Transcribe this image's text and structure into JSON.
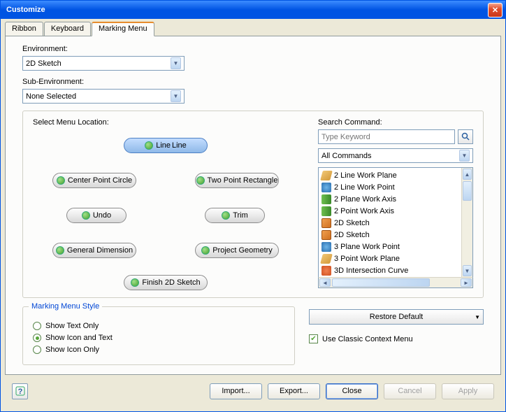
{
  "window": {
    "title": "Customize"
  },
  "tabs": {
    "t0": "Ribbon",
    "t1": "Keyboard",
    "t2": "Marking Menu"
  },
  "env": {
    "label": "Environment:",
    "value": "2D Sketch"
  },
  "subenv": {
    "label": "Sub-Environment:",
    "value": "None Selected"
  },
  "menuloc": {
    "label": "Select Menu Location:"
  },
  "pills": {
    "n": "Line",
    "n2": "Line",
    "nw": "Center Point Circle",
    "nw2": "Center Point Circle",
    "ne": "Two Point Rectangle",
    "ne2": "Two Point Rectangle",
    "w": "Undo",
    "w2": "Undo",
    "e": "Trim",
    "e2": "Trim",
    "sw": "General Dimension",
    "sw2": "General Dimension",
    "se": "Project Geometry",
    "se2": "Project Geometry",
    "s": "Finish 2D Sketch",
    "s2": "Finish 2D Sketch"
  },
  "search": {
    "label": "Search Command:",
    "placeholder": "Type Keyword"
  },
  "cmdfilter": {
    "value": "All Commands"
  },
  "list": {
    "i0": "2 Line Work Plane",
    "i1": "2 Line Work Point",
    "i2": "2 Plane Work Axis",
    "i3": "2 Point Work Axis",
    "i4": "2D Sketch",
    "i5": "2D Sketch",
    "i6": "3 Plane Work Point",
    "i7": "3 Point Work Plane",
    "i8": "3D Intersection Curve"
  },
  "style": {
    "title": "Marking Menu Style",
    "r0": "Show Text Only",
    "r1": "Show Icon and Text",
    "r2": "Show Icon Only"
  },
  "restore": {
    "label": "Restore Default"
  },
  "classic": {
    "label": "Use Classic Context Menu"
  },
  "buttons": {
    "help": "?",
    "import": "Import...",
    "export": "Export...",
    "close": "Close",
    "cancel": "Cancel",
    "apply": "Apply"
  }
}
